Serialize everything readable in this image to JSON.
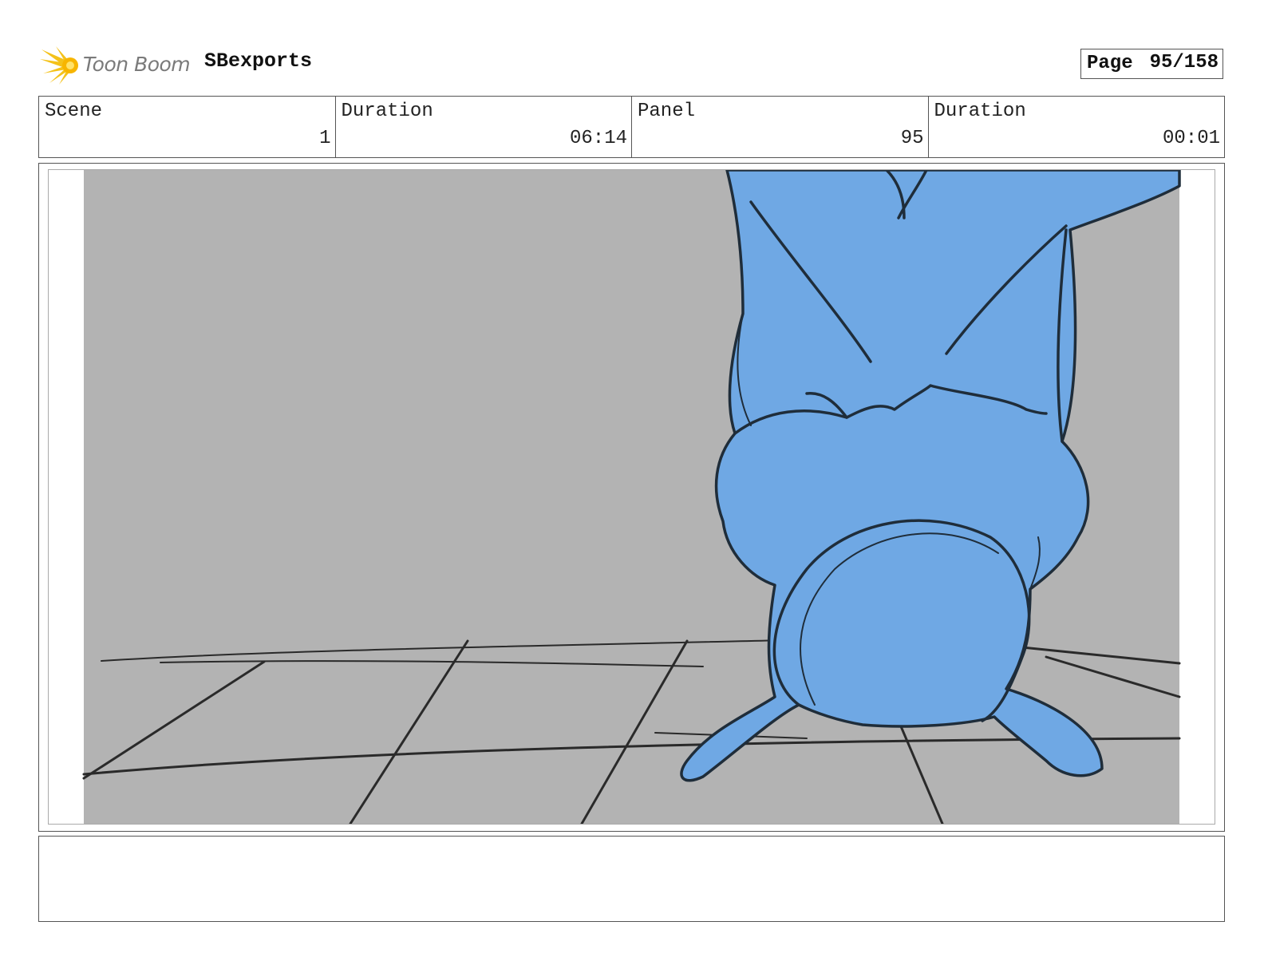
{
  "header": {
    "logo_text": "Toon Boom",
    "project_name": "SBexports",
    "page_label": "Page",
    "page_value": "95/158"
  },
  "info": [
    {
      "label": "Scene",
      "value": "1"
    },
    {
      "label": "Duration",
      "value": "06:14"
    },
    {
      "label": "Panel",
      "value": "95"
    },
    {
      "label": "Duration",
      "value": "00:01"
    }
  ],
  "panel": {
    "background_color": "#b3b3b3",
    "character_color": "#6fa8e4",
    "line_color": "#222222"
  },
  "notes": {
    "text": ""
  }
}
